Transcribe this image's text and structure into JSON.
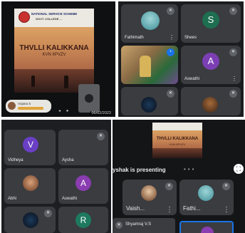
{
  "panel_tl": {
    "poster": {
      "org_line1": "NATIONAL SERVICE SCHEME",
      "org_line2": "GOVT. COLLEGE ...",
      "title": "THVLLI KALIKKANA",
      "subtitle": "KVN IIPVZV"
    },
    "commenter": {
      "name": "Anjana S"
    },
    "date": "06/02/2023"
  },
  "panel_tr": {
    "tiles": [
      {
        "name": "Fathimath"
      },
      {
        "name": "Shees",
        "initial": "S",
        "color": "#1e6e52"
      },
      {
        "name": ""
      },
      {
        "name": "Aswathi",
        "initial": "A",
        "color": "#7b3fb3"
      },
      {
        "name": ""
      },
      {
        "name": ""
      }
    ]
  },
  "panel_bl": {
    "tiles": [
      {
        "name": "Vidheya",
        "initial": "V",
        "color": "#6a3fc4"
      },
      {
        "name": "Aysha"
      },
      {
        "name": "Abhi"
      },
      {
        "name": "Aswathi",
        "initial": "A",
        "color": "#8a3db0"
      },
      {
        "name": ""
      },
      {
        "name": "",
        "initial": "R",
        "color": "#1e7a5f"
      }
    ]
  },
  "panel_br": {
    "presenting_text": "yshak is presenting",
    "poster": {
      "title": "THVLLI KALIKKANA",
      "subtitle": "KVN IIPVZV"
    },
    "tiles": [
      {
        "name": "Vaish..."
      },
      {
        "name": "Fathi..."
      }
    ],
    "self_label": "Shyamraj V.S"
  }
}
